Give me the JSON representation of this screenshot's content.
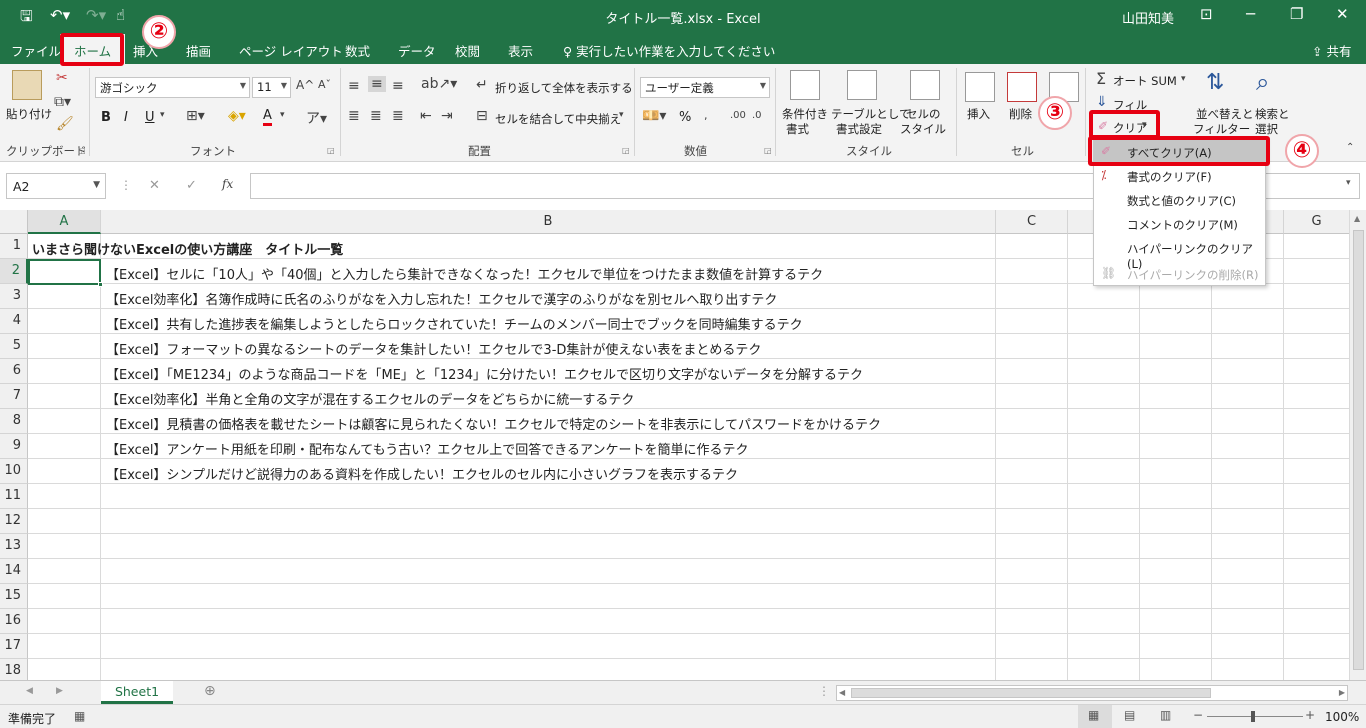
{
  "window": {
    "title": "タイトル一覧.xlsx  -  Excel",
    "user": "山田知美"
  },
  "tabs": [
    "ファイル",
    "ホーム",
    "挿入",
    "描画",
    "ページ レイアウト",
    "数式",
    "データ",
    "校閲",
    "表示"
  ],
  "tell_me": "実行したい作業を入力してください",
  "share": "共有",
  "ribbon": {
    "clipboard": {
      "paste": "貼り付け",
      "label": "クリップボード"
    },
    "font": {
      "name": "游ゴシック",
      "size": "11",
      "bold": "B",
      "italic": "I",
      "underline": "U",
      "font_color_letter": "A",
      "label": "フォント"
    },
    "alignment": {
      "wrap": "折り返して全体を表示する",
      "merge": "セルを結合して中央揃え",
      "label": "配置"
    },
    "number": {
      "format": "ユーザー定義",
      "percent": "%",
      "label": "数値"
    },
    "styles": {
      "conditional": [
        "条件付き",
        "書式"
      ],
      "table": [
        "テーブルとして",
        "書式設定"
      ],
      "cell": [
        "セルの",
        "スタイル"
      ],
      "label": "スタイル"
    },
    "cells": {
      "insert": "挿入",
      "delete": "削除",
      "label": "セル"
    },
    "editing": {
      "autosum": "オート SUM",
      "fill": "フィル",
      "clear": "クリア",
      "sort": [
        "並べ替えと",
        "フィルター"
      ],
      "find": [
        "検索と",
        "選択"
      ]
    }
  },
  "formula_bar": {
    "name_box": "A2",
    "fx": "fx",
    "cancel": "✕",
    "enter": "✓"
  },
  "columns": [
    "A",
    "B",
    "C",
    "G"
  ],
  "rows": [
    "1",
    "2",
    "3",
    "4",
    "5",
    "6",
    "7",
    "8",
    "9",
    "10",
    "11",
    "12",
    "13",
    "14",
    "15",
    "16",
    "17",
    "18"
  ],
  "cells": {
    "A1": "いまさら聞けないExcelの使い方講座　タイトル一覧",
    "B": [
      "【Excel】セルに「10人」や「40個」と入力したら集計できなくなった！エクセルで単位をつけたまま数値を計算するテク",
      "【Excel効率化】名簿作成時に氏名のふりがなを入力し忘れた！エクセルで漢字のふりがなを別セルへ取り出すテク",
      "【Excel】共有した進捗表を編集しようとしたらロックされていた！チームのメンバー同士でブックを同時編集するテク",
      "【Excel】フォーマットの異なるシートのデータを集計したい！エクセルで3-D集計が使えない表をまとめるテク",
      "【Excel】「ME1234」のような商品コードを「ME」と「1234」に分けたい！エクセルで区切り文字がないデータを分解するテク",
      "【Excel効率化】半角と全角の文字が混在するエクセルのデータをどちらかに統一するテク",
      "【Excel】見積書の価格表を載せたシートは顧客に見られたくない！エクセルで特定のシートを非表示にしてパスワードをかけるテク",
      "【Excel】アンケート用紙を印刷・配布なんてもう古い？エクセル上で回答できるアンケートを簡単に作るテク",
      "【Excel】シンプルだけど説得力のある資料を作成したい！エクセルのセル内に小さいグラフを表示するテク"
    ]
  },
  "clear_menu": [
    {
      "label": "すべてクリア(A)",
      "highlighted": true,
      "disabled": false
    },
    {
      "label": "書式のクリア(F)",
      "highlighted": false,
      "disabled": false
    },
    {
      "label": "数式と値のクリア(C)",
      "highlighted": false,
      "disabled": false
    },
    {
      "label": "コメントのクリア(M)",
      "highlighted": false,
      "disabled": false
    },
    {
      "label": "ハイパーリンクのクリア(L)",
      "highlighted": false,
      "disabled": false
    },
    {
      "label": "ハイパーリンクの削除(R)",
      "highlighted": false,
      "disabled": true
    }
  ],
  "sheet_tab": "Sheet1",
  "status": {
    "ready": "準備完了",
    "zoom": "100%"
  },
  "annotations": [
    "②",
    "③",
    "④"
  ],
  "colors": {
    "excel_green": "#217346",
    "highlight_red": "#e60012"
  }
}
